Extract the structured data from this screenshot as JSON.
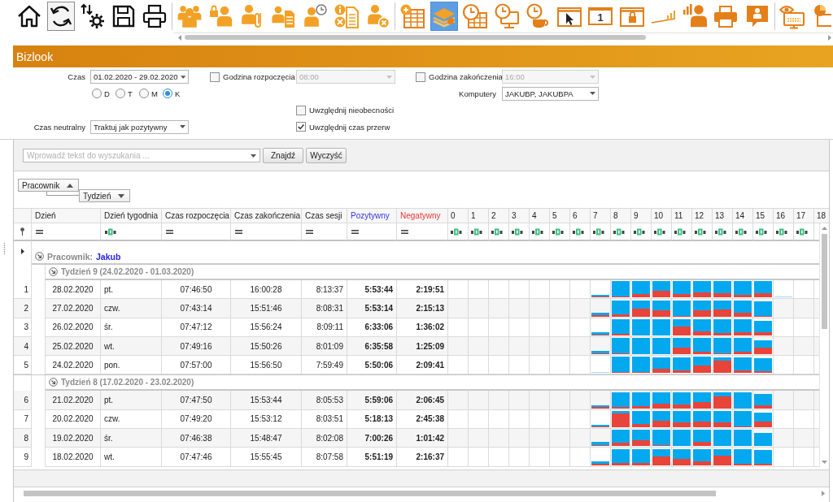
{
  "toolbar": {
    "groups": [
      [
        {
          "kind": "home",
          "selected": false,
          "focused": false
        },
        {
          "kind": "refresh",
          "selected": false,
          "focused": true
        },
        {
          "kind": "arrows-gear",
          "selected": false,
          "focused": false
        },
        {
          "kind": "save",
          "selected": false,
          "focused": false
        },
        {
          "kind": "print",
          "selected": false,
          "focused": false
        }
      ],
      [
        {
          "kind": "people",
          "selected": false,
          "focused": false
        },
        {
          "kind": "person-lock",
          "selected": false,
          "focused": false
        },
        {
          "kind": "person-clip",
          "selected": false,
          "focused": false
        },
        {
          "kind": "person-document",
          "selected": false,
          "focused": false
        },
        {
          "kind": "person-clock",
          "selected": false,
          "focused": false
        },
        {
          "kind": "info-document",
          "selected": false,
          "focused": false
        },
        {
          "kind": "person-remove",
          "selected": false,
          "focused": false
        }
      ],
      [
        {
          "kind": "table-plus",
          "selected": false,
          "focused": false
        },
        {
          "kind": "layers",
          "selected": true,
          "focused": false
        },
        {
          "kind": "clock-table",
          "selected": false,
          "focused": false
        },
        {
          "kind": "clock-monitor",
          "selected": false,
          "focused": false
        },
        {
          "kind": "clock-cup",
          "selected": false,
          "focused": false
        },
        {
          "kind": "window-cursor",
          "selected": false,
          "focused": false
        },
        {
          "kind": "window-number",
          "label": "1",
          "selected": false,
          "focused": false
        },
        {
          "kind": "window-lock",
          "selected": false,
          "focused": false
        },
        {
          "kind": "signal-bars",
          "selected": false,
          "focused": false
        },
        {
          "kind": "person-chart",
          "selected": false,
          "focused": false
        },
        {
          "kind": "printer",
          "selected": false,
          "focused": false
        },
        {
          "kind": "person-speech",
          "selected": false,
          "focused": false
        }
      ],
      [
        {
          "kind": "eye-monitor",
          "selected": false,
          "focused": false
        },
        {
          "kind": "pie-monitor",
          "selected": false,
          "focused": false
        }
      ]
    ]
  },
  "title_bar": {
    "title": "Bizlook"
  },
  "filters": {
    "time": {
      "label": "Czas",
      "value": "01.02.2020 - 29.02.2020"
    },
    "start_hour": {
      "label": "Godzina rozpoczęcia",
      "checked": false,
      "value": "08:00",
      "disabled": true
    },
    "end_hour": {
      "label": "Godzina zakończenia",
      "checked": false,
      "value": "16:00",
      "disabled": true
    },
    "period": [
      {
        "label": "D",
        "selected": false
      },
      {
        "label": "T",
        "selected": false
      },
      {
        "label": "M",
        "selected": false
      },
      {
        "label": "K",
        "selected": true
      }
    ],
    "computers": {
      "label": "Komputery",
      "value": "JAKUBP, JAKUBPA"
    },
    "include_absences": {
      "label": "Uwzględnij nieobecności",
      "checked": false
    },
    "neutral_time": {
      "label": "Czas neutralny",
      "value": "Traktuj jak pozytywny"
    },
    "include_breaks": {
      "label": "Uwzględnij czas przerw",
      "checked": true
    }
  },
  "search": {
    "placeholder": "Wprowadź tekst do wyszukania ...",
    "buttons": [
      {
        "label": "Znajdź"
      },
      {
        "label": "Wyczyść"
      }
    ]
  },
  "grouping": [
    {
      "label": "Pracownik",
      "descending": false
    },
    {
      "label": "Tydzień",
      "descending": true
    }
  ],
  "table": {
    "columns": [
      {
        "label": "Dzień",
        "kind": "date",
        "filter": {
          "kind": "equals"
        }
      },
      {
        "label": "Dzień tygodnia",
        "kind": "text",
        "filter": {
          "kind": "text"
        }
      },
      {
        "label": "Czas rozpoczęcia",
        "kind": "clock",
        "filter": {
          "kind": "equals"
        }
      },
      {
        "label": "Czas zakończenia",
        "kind": "clock",
        "filter": {
          "kind": "equals"
        }
      },
      {
        "label": "Czas sesji",
        "kind": "duration",
        "filter": {
          "kind": "equals"
        }
      },
      {
        "label": "Pozytywny",
        "kind": "total",
        "filter": {
          "kind": "equals"
        },
        "color": "#3434ee"
      },
      {
        "label": "Negatywny",
        "kind": "total",
        "filter": {
          "kind": "equals"
        },
        "color": "#ee3434"
      }
    ],
    "hour_columns": [
      {
        "label": "0",
        "filter": {
          "kind": "text"
        }
      },
      {
        "label": "1",
        "filter": {
          "kind": "text"
        }
      },
      {
        "label": "2",
        "filter": {
          "kind": "text"
        }
      },
      {
        "label": "3",
        "filter": {
          "kind": "text"
        }
      },
      {
        "label": "4",
        "filter": {
          "kind": "text"
        }
      },
      {
        "label": "5",
        "filter": {
          "kind": "text"
        }
      },
      {
        "label": "6",
        "filter": {
          "kind": "text"
        }
      },
      {
        "label": "7",
        "filter": {
          "kind": "text"
        }
      },
      {
        "label": "8",
        "filter": {
          "kind": "text"
        }
      },
      {
        "label": "9",
        "filter": {
          "kind": "text"
        }
      },
      {
        "label": "10",
        "filter": {
          "kind": "text"
        }
      },
      {
        "label": "11",
        "filter": {
          "kind": "text"
        }
      },
      {
        "label": "12",
        "filter": {
          "kind": "text"
        }
      },
      {
        "label": "13",
        "filter": {
          "kind": "text"
        }
      },
      {
        "label": "14",
        "filter": {
          "kind": "text"
        }
      },
      {
        "label": "15",
        "filter": {
          "kind": "text"
        }
      },
      {
        "label": "16",
        "filter": {
          "kind": "text"
        }
      },
      {
        "label": "17",
        "filter": {
          "kind": "text"
        }
      },
      {
        "label": "18"
      }
    ],
    "group": {
      "label": "Pracownik:",
      "value": "Jakub",
      "expanded": true,
      "focused": true
    },
    "weeks": [
      {
        "label": "Tydzień 9 (24.02.2020 - 01.03.2020)",
        "expanded": true,
        "rows": [
          {
            "number": "1",
            "cells": [
              "28.02.2020",
              "pt.",
              "07:46:50",
              "16:00:28",
              "8:13:37",
              "5:53:44",
              "2:19:51"
            ]
          },
          {
            "number": "2",
            "cells": [
              "27.02.2020",
              "czw.",
              "07:43:14",
              "15:51:46",
              "8:08:31",
              "5:53:14",
              "2:15:13"
            ]
          },
          {
            "number": "3",
            "cells": [
              "26.02.2020",
              "śr.",
              "07:47:12",
              "15:56:24",
              "8:09:11",
              "6:33:06",
              "1:36:02"
            ]
          },
          {
            "number": "4",
            "cells": [
              "25.02.2020",
              "wt.",
              "07:49:16",
              "15:50:26",
              "8:01:09",
              "6:35:58",
              "1:25:09"
            ]
          },
          {
            "number": "5",
            "cells": [
              "24.02.2020",
              "pon.",
              "07:57:00",
              "15:56:50",
              "7:59:49",
              "5:50:06",
              "2:09:41"
            ]
          }
        ]
      },
      {
        "label": "Tydzień 8 (17.02.2020 - 23.02.2020)",
        "expanded": true,
        "rows": [
          {
            "number": "6",
            "cells": [
              "21.02.2020",
              "pt.",
              "07:47:50",
              "15:53:44",
              "8:05:53",
              "5:59:06",
              "2:06:45"
            ]
          },
          {
            "number": "7",
            "cells": [
              "20.02.2020",
              "czw.",
              "07:49:20",
              "15:53:12",
              "8:03:51",
              "5:18:13",
              "2:45:38"
            ]
          },
          {
            "number": "8",
            "cells": [
              "19.02.2020",
              "śr.",
              "07:46:38",
              "15:48:47",
              "8:02:08",
              "7:00:26",
              "1:01:42"
            ]
          },
          {
            "number": "9",
            "cells": [
              "18.02.2020",
              "wt.",
              "07:47:46",
              "15:55:45",
              "8:07:58",
              "5:51:19",
              "2:16:37"
            ]
          }
        ]
      }
    ]
  }
}
